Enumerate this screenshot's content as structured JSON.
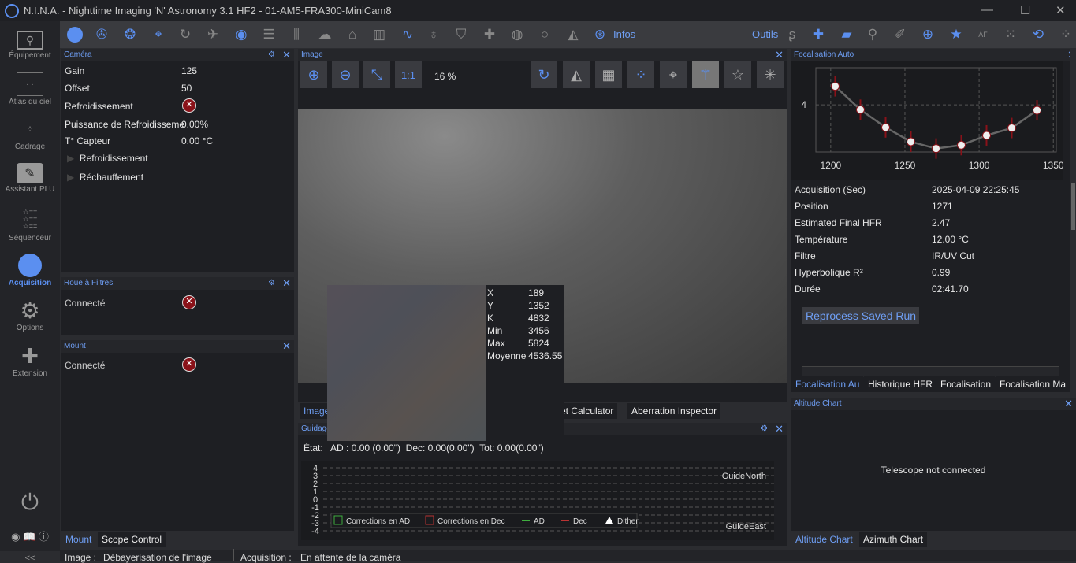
{
  "window": {
    "title": "N.I.N.A. - Nighttime Imaging 'N' Astronomy 3.1 HF2   -  01-AM5-FRA300-MiniCam8",
    "minimize": "—",
    "maximize": "☐",
    "close": "✕"
  },
  "toolbar": {
    "infos_label": "Infos",
    "tools_label": "Outils"
  },
  "sidebar": {
    "items": [
      {
        "label": "Équipement"
      },
      {
        "label": "Atlas du ciel"
      },
      {
        "label": "Cadrage"
      },
      {
        "label": "Assistant PLU"
      },
      {
        "label": "Séquenceur"
      },
      {
        "label": "Acquisition",
        "active": true
      },
      {
        "label": "Options"
      },
      {
        "label": "Extension"
      }
    ],
    "collapse": "<<"
  },
  "camera": {
    "title": "Caméra",
    "rows": [
      {
        "label": "Gain",
        "value": "125"
      },
      {
        "label": "Offset",
        "value": "50"
      },
      {
        "label": "Refroidissement",
        "value": ""
      },
      {
        "label": "Puissance de Refroidisseme",
        "value": "0.00%"
      },
      {
        "label": "T° Capteur",
        "value": "0.00 °C"
      }
    ],
    "expanders": [
      "Refroidissement",
      "Réchauffement"
    ]
  },
  "filter_wheel": {
    "title": "Roue à Filtres",
    "connected_label": "Connecté"
  },
  "mount": {
    "title": "Mount",
    "connected_label": "Connecté"
  },
  "left_tabs": [
    "Mount",
    "Scope Control"
  ],
  "image": {
    "title": "Image",
    "zoom": "16 %",
    "one_to_one": "1:1",
    "tabs": [
      "Image",
      "set Calculator",
      "Aberration Inspector"
    ],
    "pixel_info": [
      {
        "k": "X",
        "v": "189"
      },
      {
        "k": "Y",
        "v": "1352"
      },
      {
        "k": "K",
        "v": "4832"
      },
      {
        "k": "Min",
        "v": "3456"
      },
      {
        "k": "Max",
        "v": "5824"
      },
      {
        "k": "Moyenne",
        "v": "4536.55"
      }
    ]
  },
  "guiding": {
    "title": "Guidage",
    "state": "État:   AD : 0.00 (0.00\")  Dec: 0.00(0.00\")  Tot: 0.00(0.00\")",
    "chart": {
      "yticks": [
        "4",
        "3",
        "2",
        "1",
        "0",
        "-1",
        "-2",
        "-3",
        "-4"
      ],
      "north_label": "GuideNorth",
      "east_label": "GuideEast",
      "legend": [
        {
          "label": "Corrections en AD",
          "color": "#3fae3f",
          "kind": "box"
        },
        {
          "label": "Corrections en Dec",
          "color": "#b33",
          "kind": "box"
        },
        {
          "label": "AD",
          "color": "#3fae3f",
          "kind": "line"
        },
        {
          "label": "Dec",
          "color": "#b33",
          "kind": "line"
        },
        {
          "label": "Dither",
          "color": "#fff",
          "kind": "triangle"
        }
      ]
    }
  },
  "autofocus": {
    "title": "Focalisation Auto",
    "info": [
      {
        "k": "Acquisition (Sec)",
        "v": "2025-04-09 22:25:45"
      },
      {
        "k": "Position",
        "v": "1271"
      },
      {
        "k": "Estimated Final HFR",
        "v": "2.47"
      },
      {
        "k": "Température",
        "v": "12.00 °C"
      },
      {
        "k": "Filtre",
        "v": "IR/UV Cut"
      },
      {
        "k": "Hyperbolique R²",
        "v": "0.99"
      },
      {
        "k": "Durée",
        "v": "02:41.70"
      }
    ],
    "reprocess_label": "Reprocess Saved Run",
    "tabs": [
      "Focalisation Au",
      "Historique HFR",
      "Focalisation",
      "Focalisation Ma"
    ]
  },
  "chart_data": {
    "type": "scatter",
    "x": [
      1203,
      1220,
      1237,
      1254,
      1271,
      1288,
      1305,
      1322,
      1339
    ],
    "y": [
      4.65,
      3.83,
      3.21,
      2.71,
      2.47,
      2.59,
      2.93,
      3.19,
      3.81
    ],
    "xticks": [
      "1200",
      "1250",
      "1300",
      "1350"
    ],
    "yticks": [
      "4"
    ],
    "xlim": [
      1190,
      1352
    ],
    "ylim": [
      2.35,
      5.3
    ],
    "grid": true,
    "trendline": true,
    "error_bars": true
  },
  "altitude": {
    "title": "Altitude Chart",
    "message": "Telescope not connected",
    "tabs": [
      "Altitude Chart",
      "Azimuth Chart"
    ]
  },
  "status": {
    "image_label": "Image :",
    "image_value": "Débayerisation de l'image",
    "acq_label": "Acquisition :",
    "acq_value": "En attente de la caméra"
  },
  "colors": {
    "accent": "#5b8ff0",
    "error": "#8a1219",
    "bg": "#1e1f23"
  }
}
